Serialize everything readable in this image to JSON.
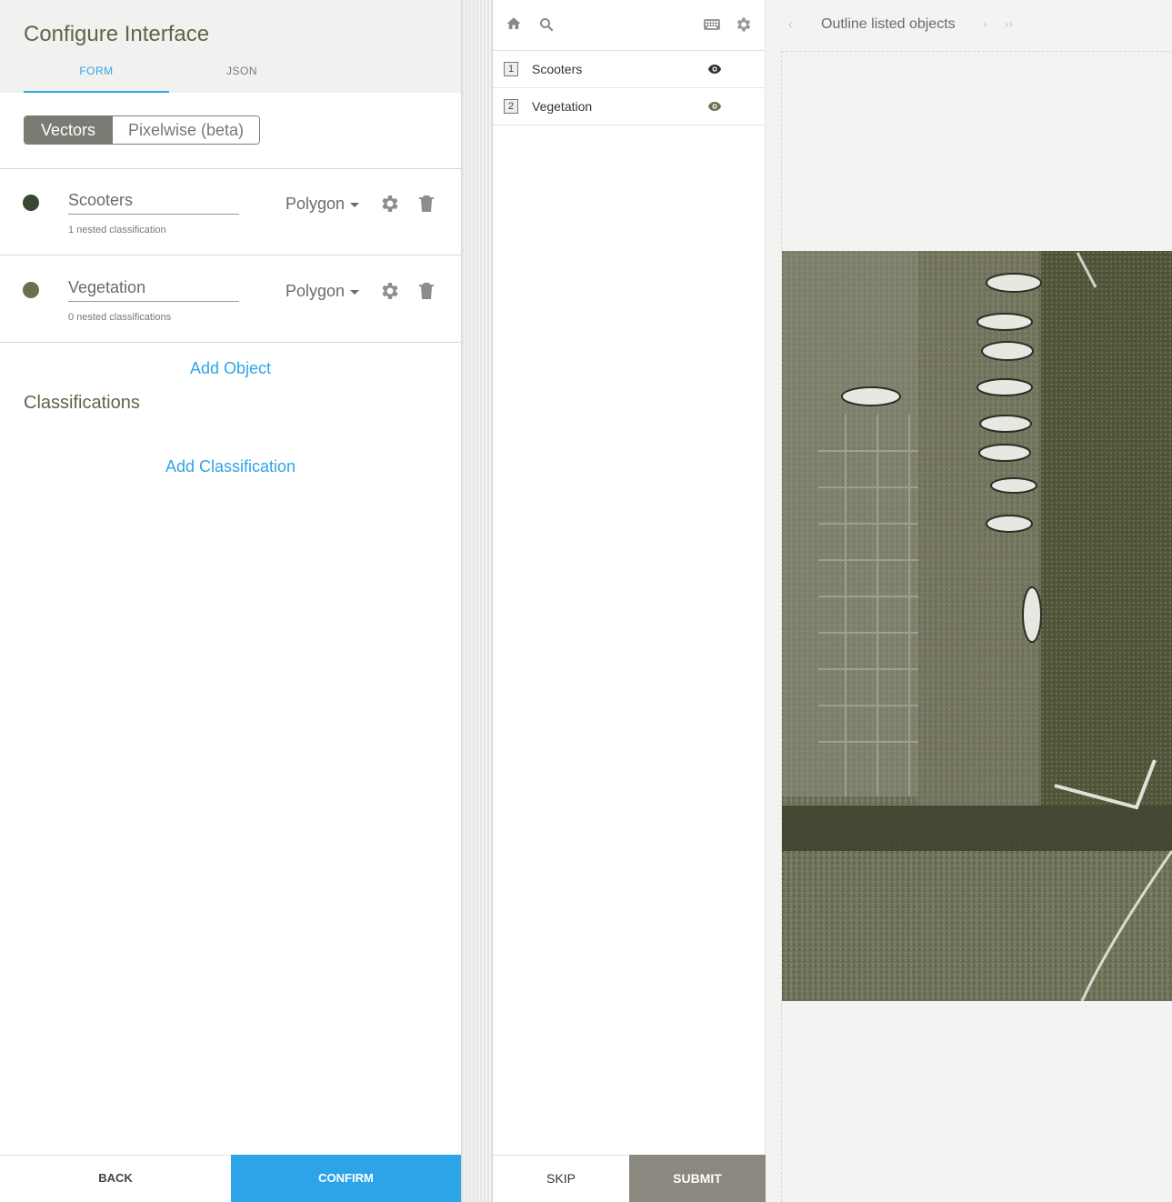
{
  "config": {
    "title": "Configure Interface",
    "tabs": [
      "FORM",
      "JSON"
    ],
    "modes": [
      "Vectors",
      "Pixelwise (beta)"
    ],
    "objects": [
      {
        "name": "Scooters",
        "nested": "1 nested classification",
        "tool": "Polygon",
        "color": "#3b4630"
      },
      {
        "name": "Vegetation",
        "nested": "0 nested classifications",
        "tool": "Polygon",
        "color": "#6b7150"
      }
    ],
    "add_object": "Add Object",
    "classifications_title": "Classifications",
    "add_classification": "Add Classification",
    "back_label": "BACK",
    "confirm_label": "CONFIRM"
  },
  "tools": {
    "items": [
      {
        "key": "1",
        "label": "Scooters"
      },
      {
        "key": "2",
        "label": "Vegetation"
      }
    ],
    "skip_label": "SKIP",
    "submit_label": "SUBMIT"
  },
  "canvas": {
    "title": "Outline listed objects",
    "image_description": "aerial-parking-lot-with-scooters"
  },
  "colors": {
    "accent": "#2ea4e8",
    "submit_bg": "#8a887f",
    "toggle_active": "#7b7b74"
  },
  "icons": [
    "home-icon",
    "search-icon",
    "keyboard-icon",
    "gear-icon",
    "eye-icon",
    "trash-icon",
    "chevron-left-icon",
    "chevron-right-icon",
    "double-chevron-right-icon"
  ]
}
